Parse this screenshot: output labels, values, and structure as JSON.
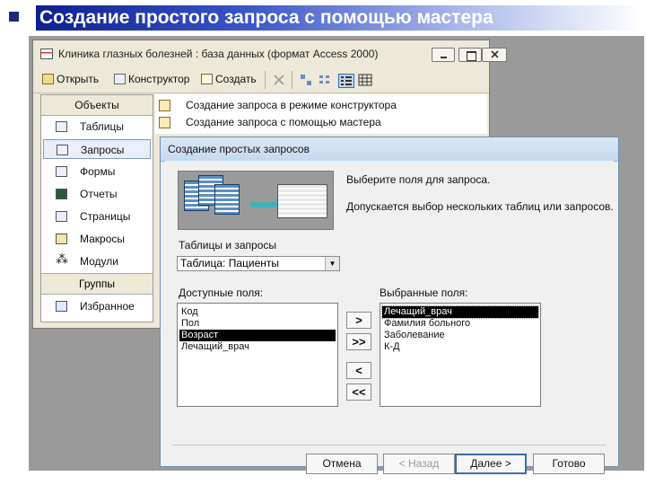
{
  "slide": {
    "title": "Создание простого запроса с помощью мастера"
  },
  "db_window": {
    "title": "Клиника глазных болезней : база данных (формат Access 2000)",
    "toolbar": {
      "open": "Открыть",
      "designer": "Конструктор",
      "create": "Создать"
    },
    "objects_header": "Объекты",
    "objects": [
      {
        "label": "Таблицы",
        "icon": "table-icon"
      },
      {
        "label": "Запросы",
        "icon": "query-icon"
      },
      {
        "label": "Формы",
        "icon": "form-icon"
      },
      {
        "label": "Отчеты",
        "icon": "report-icon"
      },
      {
        "label": "Страницы",
        "icon": "page-icon"
      },
      {
        "label": "Макросы",
        "icon": "macro-icon"
      },
      {
        "label": "Модули",
        "icon": "module-icon"
      }
    ],
    "groups_header": "Группы",
    "favorites": "Избранное",
    "query_items": [
      "Создание запроса в режиме конструктора",
      "Создание запроса с помощью мастера"
    ]
  },
  "wizard": {
    "title": "Создание простых запросов",
    "instruction1": "Выберите поля для запроса.",
    "instruction2": "Допускается выбор нескольких таблиц или запросов.",
    "tables_label": "Таблицы и запросы",
    "table_selected": "Таблица: Пациенты",
    "available_label": "Доступные поля:",
    "selected_label": "Выбранные поля:",
    "available_fields": [
      "Код",
      "Пол",
      "Возраст",
      "Лечащий_врач"
    ],
    "available_selected_index": 2,
    "selected_fields": [
      "Лечащий_врач",
      "Фамилия больного",
      "Заболевание",
      "К-Д"
    ],
    "move_buttons": {
      "one": ">",
      "all": ">>",
      "back_one": "<",
      "back_all": "<<"
    },
    "buttons": {
      "cancel": "Отмена",
      "back": "< Назад",
      "next": "Далее >",
      "finish": "Готово"
    }
  },
  "colors": {
    "title_bar_start": "#0e1f8f",
    "selection": "#000000",
    "wizard_border": "#6e8fb3"
  }
}
